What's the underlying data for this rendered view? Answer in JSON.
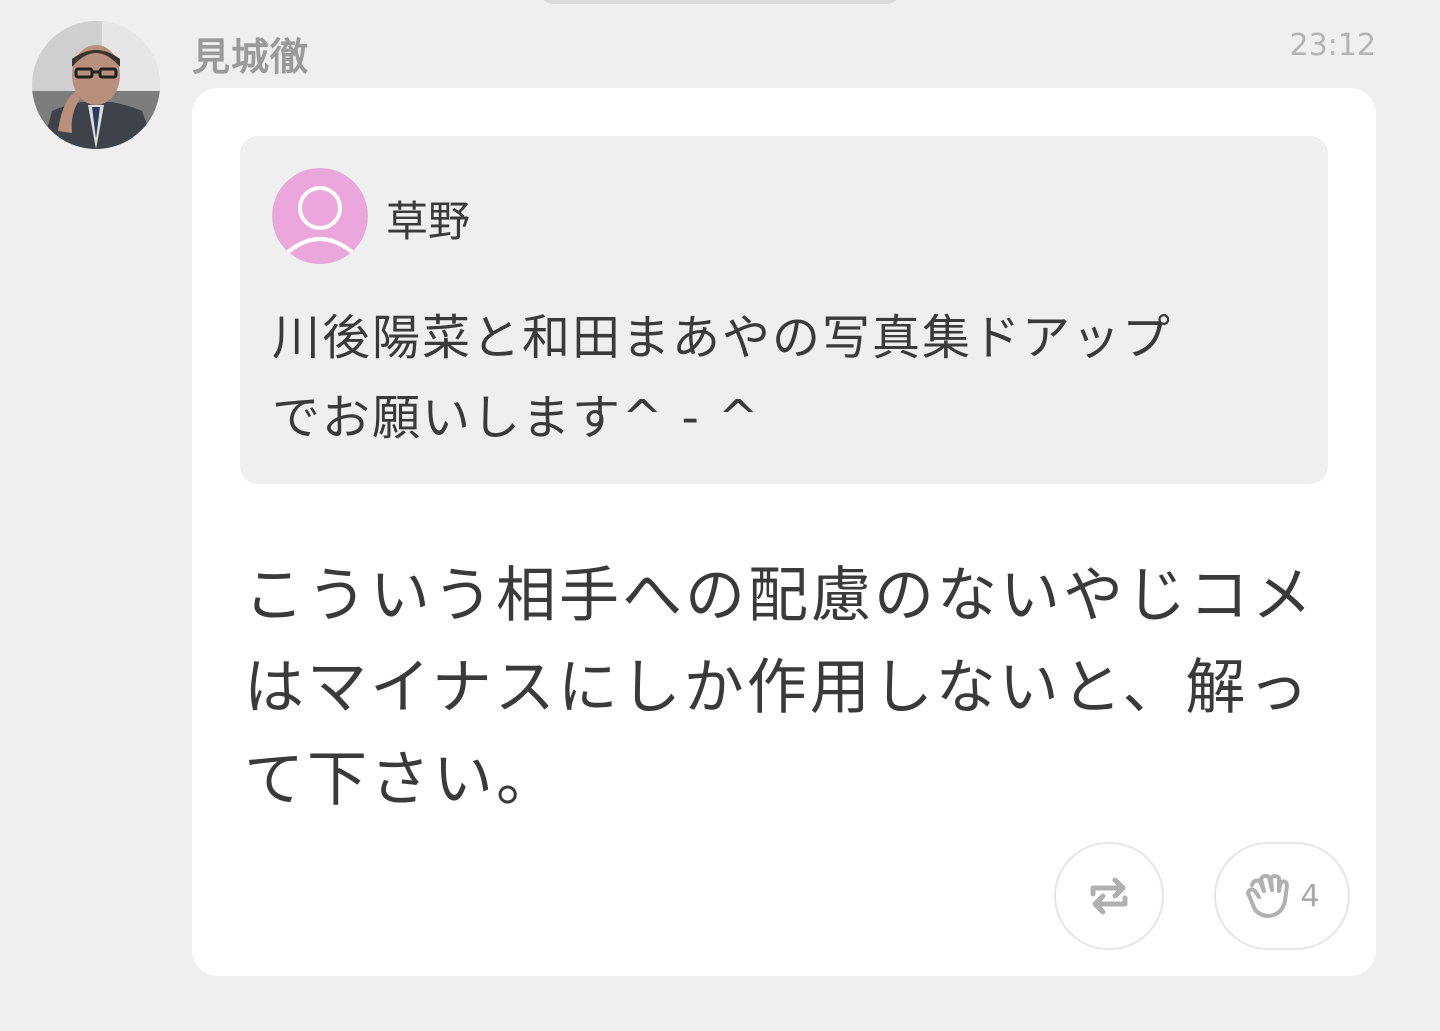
{
  "post": {
    "author_name": "見城徹",
    "timestamp": "23:12",
    "quoted": {
      "author_name": "草野",
      "text": "川後陽菜と和田まあやの写真集ドアップ\nでお願いします^ - ^"
    },
    "body": "こういう相手への配慮のないやじコメ\nはマイナスにしか作用しないと、解っ\nて下さい。",
    "actions": {
      "repost_icon": "repost-icon",
      "clap_icon": "clap-icon",
      "clap_count": "4"
    }
  },
  "colors": {
    "background": "#efefef",
    "card": "#ffffff",
    "quote_background": "#efefef",
    "default_avatar": "#eba7dc",
    "text": "#3a3a3a",
    "muted": "#9a9a9a"
  }
}
